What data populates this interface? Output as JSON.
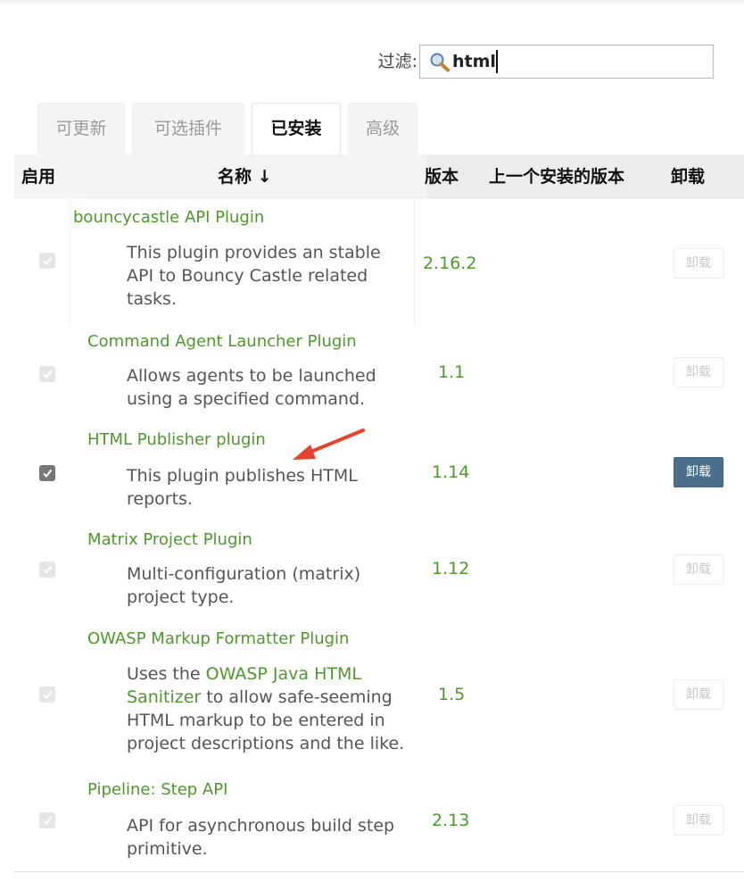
{
  "filter": {
    "label": "过滤:",
    "value": "html",
    "icon": "magnifier-icon"
  },
  "tabs": [
    {
      "label": "可更新",
      "active": false
    },
    {
      "label": "可选插件",
      "active": false
    },
    {
      "label": "已安装",
      "active": true
    },
    {
      "label": "高级",
      "active": false
    }
  ],
  "table": {
    "headers": {
      "enabled": "启用",
      "name": "名称 ↓",
      "version": "版本",
      "previous_version": "上一个安装的版本",
      "uninstall": "卸载"
    },
    "rows": [
      {
        "name": "bouncycastle API Plugin",
        "description": "This plugin provides an stable API to Bouncy Castle related tasks.",
        "version": "2.16.2",
        "enabled": true,
        "checkbox_disabled": true,
        "uninstall_label": "卸载",
        "uninstall_enabled": false
      },
      {
        "name": "Command Agent Launcher Plugin",
        "description": "Allows agents to be launched using a specified command.",
        "version": "1.1",
        "enabled": true,
        "checkbox_disabled": true,
        "uninstall_label": "卸载",
        "uninstall_enabled": false
      },
      {
        "name": "HTML Publisher plugin",
        "description": "This plugin publishes HTML reports.",
        "version": "1.14",
        "enabled": true,
        "checkbox_disabled": false,
        "uninstall_label": "卸载",
        "uninstall_enabled": true
      },
      {
        "name": "Matrix Project Plugin",
        "description": "Multi-configuration (matrix) project type.",
        "version": "1.12",
        "enabled": true,
        "checkbox_disabled": true,
        "uninstall_label": "卸载",
        "uninstall_enabled": false
      },
      {
        "name": "OWASP Markup Formatter Plugin",
        "description_prefix": "Uses the ",
        "description_link": "OWASP Java HTML Sanitizer",
        "description_suffix": " to allow safe-seeming HTML markup to be entered in project descriptions and the like.",
        "version": "1.5",
        "enabled": true,
        "checkbox_disabled": true,
        "uninstall_label": "卸载",
        "uninstall_enabled": false
      },
      {
        "name": "Pipeline: Step API",
        "description": "API for asynchronous build step primitive.",
        "version": "2.13",
        "enabled": true,
        "checkbox_disabled": true,
        "uninstall_label": "卸载",
        "uninstall_enabled": false
      }
    ]
  },
  "annotation": {
    "color": "#e8412c",
    "icon": "red-arrow-annotation"
  }
}
